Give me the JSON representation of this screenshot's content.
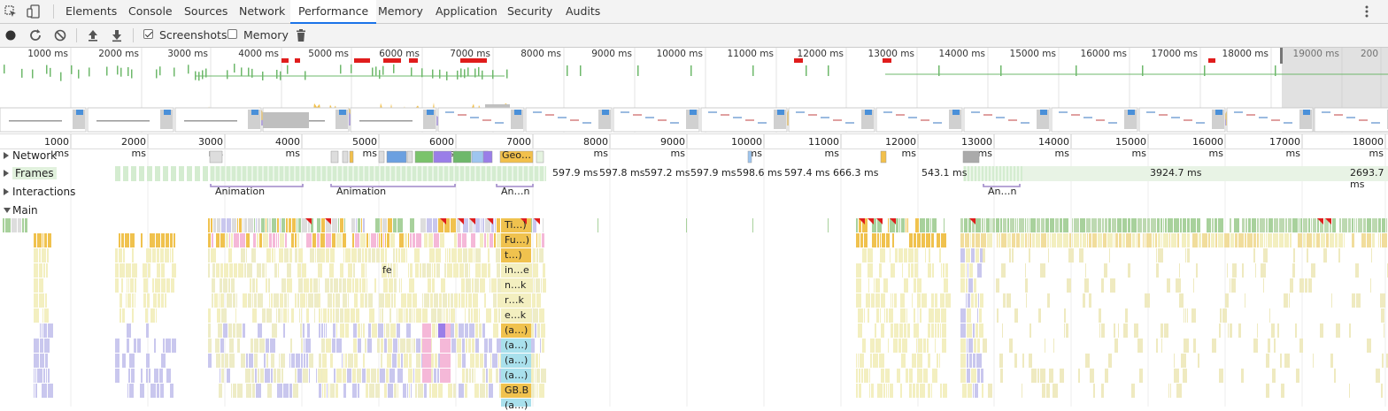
{
  "tabs": [
    {
      "label": "Elements",
      "active": false
    },
    {
      "label": "Console",
      "active": false
    },
    {
      "label": "Sources",
      "active": false
    },
    {
      "label": "Network",
      "active": false
    },
    {
      "label": "Performance",
      "active": true
    },
    {
      "label": "Memory",
      "active": false
    },
    {
      "label": "Application",
      "active": false
    },
    {
      "label": "Security",
      "active": false
    },
    {
      "label": "Audits",
      "active": false
    }
  ],
  "toolbar": {
    "screenshots_label": "Screenshots",
    "screenshots_checked": true,
    "memory_label": "Memory",
    "memory_checked": false
  },
  "overview_ticks": [
    "1000 ms",
    "2000 ms",
    "3000 ms",
    "4000 ms",
    "5000 ms",
    "6000 ms",
    "7000 ms",
    "8000 ms",
    "9000 ms",
    "10000 ms",
    "11000 ms",
    "12000 ms",
    "13000 ms",
    "14000 ms",
    "15000 ms",
    "16000 ms",
    "17000 ms",
    "18000 ms",
    "19000 ms",
    "200"
  ],
  "ruler_ticks": [
    "1000 ms",
    "2000 ms",
    "3000 ms",
    "4000 ms",
    "5000 ms",
    "6000 ms",
    "7000 ms",
    "8000 ms",
    "9000 ms",
    "10000 ms",
    "11000 ms",
    "12000 ms",
    "13000 ms",
    "14000 ms",
    "15000 ms",
    "16000 ms",
    "17000 ms",
    "18000 ms"
  ],
  "tracks": {
    "network": "Network",
    "frames": "Frames",
    "interactions": "Interactions",
    "main": "Main"
  },
  "network_label": "Geo…",
  "frame_times": [
    "597.9 ms",
    "597.8 ms",
    "597.2 ms",
    "597.9 ms",
    "598.6 ms",
    "597.4 ms",
    "666.3 ms",
    "543.1 ms",
    "3924.7 ms",
    "2693.7 ms"
  ],
  "interactions": [
    "Animation",
    "Animation",
    "An…n",
    "An…n"
  ],
  "main_labels": [
    "Ti…)",
    "Fu…)",
    "t…)",
    "in…e",
    "n…k",
    "r…k",
    "e…k",
    "(a…)",
    "(a…)",
    "(a…)",
    "(a…)",
    "GB.B",
    "(a…)"
  ],
  "main_fe_label": "fe",
  "colors": {
    "accent": "#1a73e8",
    "scripting": "#f2c04b",
    "rendering": "#9a7ee8",
    "painting": "#6eb86b",
    "system": "#c0c0c0",
    "frame": "#d4ecd0",
    "idle_frame": "#e8f3e5",
    "interaction": "#9f89c9",
    "task_green": "#a8d19c",
    "task_yellow": "#f0c24e",
    "light_yellow": "#f3efc0",
    "lavender": "#c9c7ee",
    "pink": "#f5b8d8",
    "cyan": "#a9e0ec",
    "red": "#e01c1c"
  }
}
